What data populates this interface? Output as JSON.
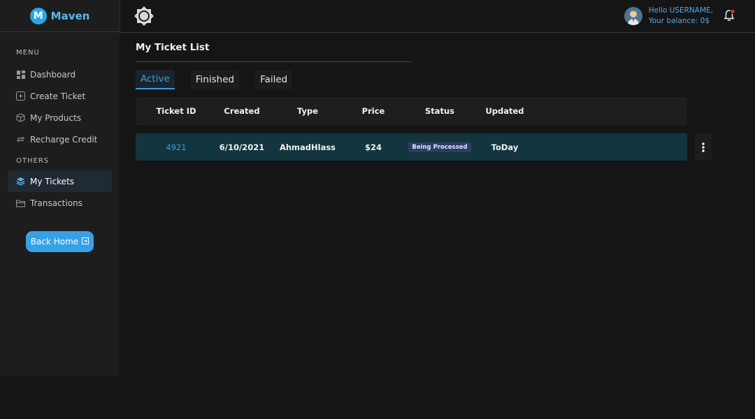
{
  "brand": {
    "logo_letter": "M",
    "name": "Maven",
    "accent": "#27a9e6"
  },
  "sidebar": {
    "section_menu": "MENU",
    "section_others": "OTHERS",
    "items": [
      {
        "label": "Dashboard",
        "icon": "dashboard-icon"
      },
      {
        "label": "Create Ticket",
        "icon": "plus-square-icon"
      },
      {
        "label": "My Products",
        "icon": "box-icon"
      },
      {
        "label": "Recharge Credit",
        "icon": "repeat-icon"
      },
      {
        "label": "My Tickets",
        "icon": "layers-icon",
        "active": true
      },
      {
        "label": "Transactions",
        "icon": "folder-icon"
      }
    ],
    "back_home_label": "Back Home"
  },
  "header": {
    "greeting": "Hello USERNAME,",
    "balance": "Your balance: 0$"
  },
  "main": {
    "title": "My Ticket List",
    "tabs": [
      {
        "label": "Active",
        "active": true
      },
      {
        "label": "Finished"
      },
      {
        "label": "Failed"
      }
    ],
    "columns": [
      "Ticket ID",
      "Created",
      "Type",
      "Price",
      "Status",
      "Updated"
    ],
    "rows": [
      {
        "id": "4921",
        "created": "6/10/2021",
        "type": "AhmadHlass",
        "price": "$24",
        "status": "Being Processed",
        "updated": "ToDay"
      }
    ]
  }
}
